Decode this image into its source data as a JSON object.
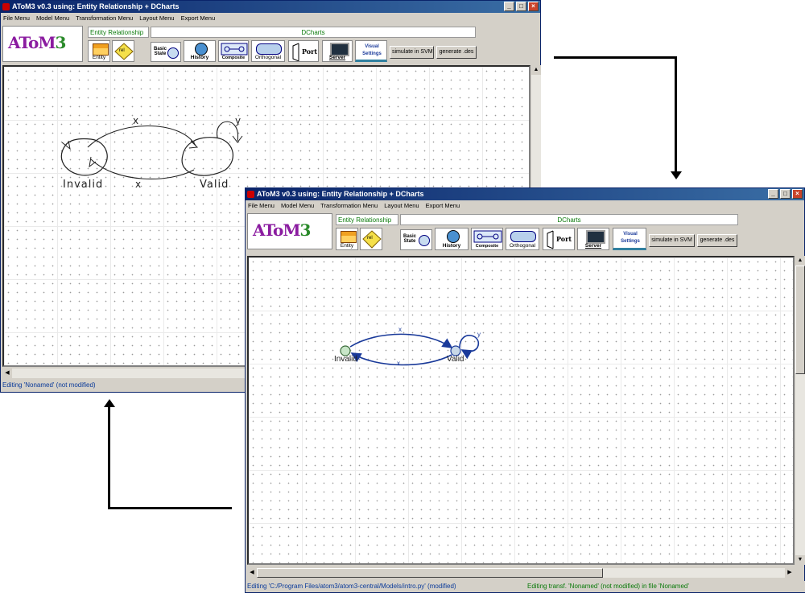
{
  "window_back": {
    "title": "AToM3 v0.3 using: Entity Relationship + DCharts",
    "menus": [
      "File Menu",
      "Model Menu",
      "Transformation Menu",
      "Layout Menu",
      "Export Menu"
    ],
    "formalism_label": "Entity Relationship",
    "dcharts_label": "DCharts",
    "tools": {
      "entity": "Entity",
      "rel": "rel",
      "basic_state": "Basic State",
      "history": "History",
      "composite": "Composite",
      "orthogonal": "Orthogonal",
      "port": "Port",
      "server": "Server",
      "visual_settings": "Visual Settings"
    },
    "buttons": {
      "simulate": "simulate in SVM",
      "generate": "generate .des"
    },
    "sketch": {
      "state1": "Invalid",
      "state2": "Valid",
      "edge_top": "x",
      "edge_bottom": "x",
      "edge_self": "y"
    },
    "status": "Editing 'Nonamed' (not modified)"
  },
  "window_front": {
    "title": "AToM3 v0.3 using: Entity Relationship + DCharts",
    "menus": [
      "File Menu",
      "Model Menu",
      "Transformation Menu",
      "Layout Menu",
      "Export Menu"
    ],
    "formalism_label": "Entity Relationship",
    "dcharts_label": "DCharts",
    "tools": {
      "entity": "Entity",
      "rel": "rel",
      "basic_state": "Basic State",
      "history": "History",
      "composite": "Composite",
      "orthogonal": "Orthogonal",
      "port": "Port",
      "server": "Server",
      "visual_settings": "Visual Settings"
    },
    "buttons": {
      "simulate": "simulate in SVM",
      "generate": "generate .des"
    },
    "diagram": {
      "state1": "Invalid",
      "state2": "Valid",
      "edge_top": "x",
      "edge_bottom": "x",
      "edge_self": "y"
    },
    "status_left": "Editing 'C:/Program Files/atom3/atom3-central/Models/intro.py' (modified)",
    "status_right": "Editing transf. 'Nonamed' (not modified) in file 'Nonamed'"
  },
  "colors": {
    "title_bar": "#0a246a",
    "status_text": "#0a3a9a",
    "green_text": "#0a7a0a",
    "edge": "#1a3a9a",
    "state_fill": "#c8e6c8"
  },
  "icons": [
    "app-icon",
    "minimize-icon",
    "maximize-icon",
    "close-icon",
    "atom3-logo",
    "entity-icon",
    "rel-icon",
    "basic-state-icon",
    "history-icon",
    "composite-icon",
    "orthogonal-icon",
    "port-icon",
    "server-icon",
    "visual-settings-icon",
    "arrow-connector"
  ]
}
